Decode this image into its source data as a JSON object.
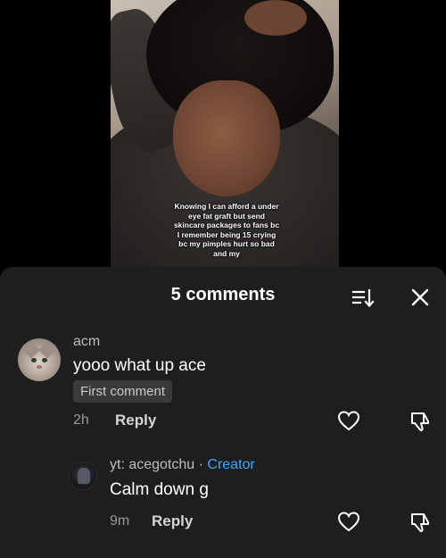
{
  "video": {
    "caption": "Knowing I can afford a under eye fat graft but send skincare packages to fans bc I remember being 15 crying bc my pimples hurt so bad and my"
  },
  "comments_panel": {
    "title": "5 comments",
    "sort_icon": "sort-icon",
    "close_icon": "close-icon",
    "comments": [
      {
        "username": "acm",
        "text": "yooo what up ace",
        "badge": "First comment",
        "time": "2h",
        "reply_label": "Reply",
        "avatar": "cat-avatar"
      },
      {
        "username": "yt: acegotchu",
        "separator": " · ",
        "creator_label": "Creator",
        "text": "Calm down g",
        "time": "9m",
        "reply_label": "Reply",
        "avatar": "user-avatar"
      }
    ]
  },
  "colors": {
    "sheet_bg": "#1e1e1e",
    "creator_blue": "#3ea6ff",
    "text_primary": "#ffffff",
    "text_secondary": "#9a9a9a"
  }
}
